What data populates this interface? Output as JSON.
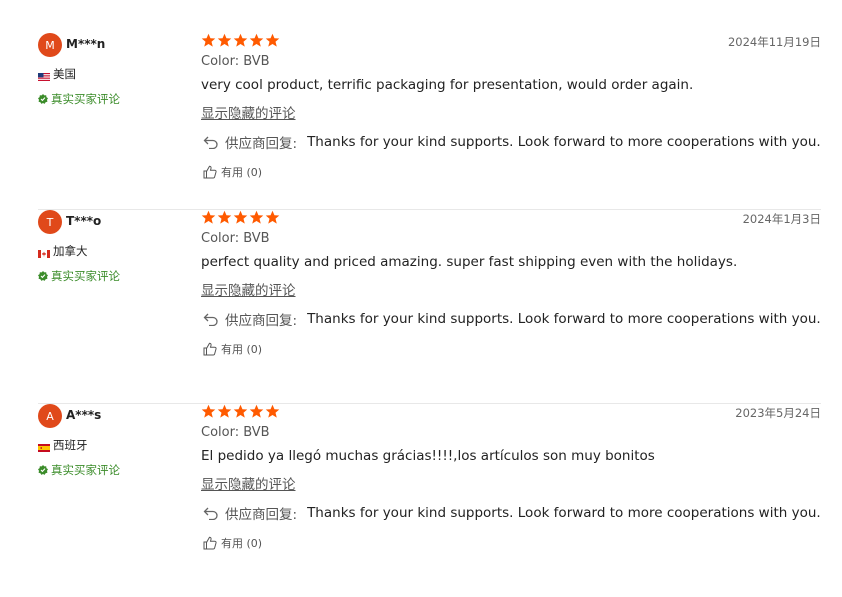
{
  "reviews": [
    {
      "avatar_letter": "M",
      "name": "M***n",
      "country": "美国",
      "flag": "us",
      "verified": "真实买家评论",
      "rating": 5,
      "date": "2024年11月19日",
      "color_label": "Color:",
      "color_value": "BVB",
      "text": "very cool product, terrific packaging for presentation, would order again.",
      "show_hidden": "显示隐藏的评论",
      "reply_label": "供应商回复:",
      "reply_text": "Thanks for your kind supports. Look forward to more cooperations with you.",
      "helpful": "有用 (0)"
    },
    {
      "avatar_letter": "T",
      "name": "T***o",
      "country": "加拿大",
      "flag": "ca",
      "verified": "真实买家评论",
      "rating": 5,
      "date": "2024年1月3日",
      "color_label": "Color:",
      "color_value": "BVB",
      "text": "perfect quality and priced amazing. super fast shipping even with the holidays.",
      "show_hidden": "显示隐藏的评论",
      "reply_label": "供应商回复:",
      "reply_text": "Thanks for your kind supports. Look forward to more cooperations with you.",
      "helpful": "有用 (0)"
    },
    {
      "avatar_letter": "A",
      "name": "A***s",
      "country": "西班牙",
      "flag": "es",
      "verified": "真实买家评论",
      "rating": 5,
      "date": "2023年5月24日",
      "color_label": "Color:",
      "color_value": "BVB",
      "text": "El pedido ya llegó muchas grácias!!!!,los artículos son muy bonitos",
      "show_hidden": "显示隐藏的评论",
      "reply_label": "供应商回复:",
      "reply_text": "Thanks for your kind supports. Look forward to more cooperations with you.",
      "helpful": "有用 (0)"
    }
  ],
  "colors": {
    "star": "#ff5a00",
    "avatar": "#e0491a",
    "verified": "#3b8c2a"
  }
}
